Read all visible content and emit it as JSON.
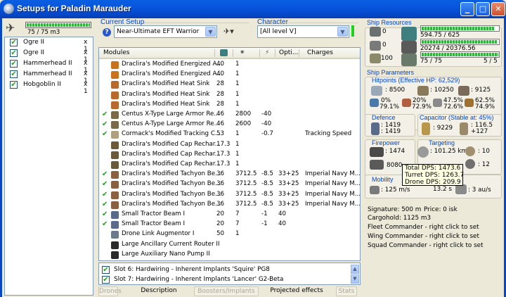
{
  "window": {
    "title": "Setups for Paladin Marauder",
    "minimize": "_",
    "maximize": "□",
    "close": "✕"
  },
  "cargo": {
    "text": "75 / 75 m3",
    "fill": 1.0
  },
  "drones": [
    {
      "name": "Ogre II",
      "qty": "x 1"
    },
    {
      "name": "Ogre II",
      "qty": "x 1"
    },
    {
      "name": "Hammerhead II",
      "qty": "x 1"
    },
    {
      "name": "Hammerhead II",
      "qty": "x 1"
    },
    {
      "name": "Hobgoblin II",
      "qty": "x 1"
    }
  ],
  "setup": {
    "label": "Current Setup",
    "value": "Near-Ultimate EFT Warrior"
  },
  "character": {
    "label": "Character",
    "value": "[All level V]"
  },
  "modules": {
    "headers": {
      "name": "Modules",
      "opti": "Opti...",
      "charges": "Charges"
    },
    "rows": [
      {
        "mark": "",
        "name": "Draclira's Modified Energized A...",
        "cpu": "40",
        "pg": "1",
        "range": "",
        "opti": "",
        "charges": "",
        "icon": "#c9741c"
      },
      {
        "mark": "",
        "name": "Draclira's Modified Energized A...",
        "cpu": "40",
        "pg": "1",
        "range": "",
        "opti": "",
        "charges": "",
        "icon": "#c9741c"
      },
      {
        "mark": "",
        "name": "Draclira's Modified Heat Sink",
        "cpu": "28",
        "pg": "1",
        "range": "",
        "opti": "",
        "charges": "",
        "icon": "#b86a2c"
      },
      {
        "mark": "",
        "name": "Draclira's Modified Heat Sink",
        "cpu": "28",
        "pg": "1",
        "range": "",
        "opti": "",
        "charges": "",
        "icon": "#b86a2c"
      },
      {
        "mark": "",
        "name": "Draclira's Modified Heat Sink",
        "cpu": "28",
        "pg": "1",
        "range": "",
        "opti": "",
        "charges": "",
        "icon": "#b86a2c"
      },
      {
        "mark": "✔",
        "name": "Centus X-Type Large Armor Re...",
        "cpu": "46",
        "pg": "2800",
        "range": "-40",
        "opti": "",
        "charges": "",
        "icon": "#7a6a4a"
      },
      {
        "mark": "✔",
        "name": "Centus A-Type Large Armor Re...",
        "cpu": "46",
        "pg": "2600",
        "range": "-40",
        "opti": "",
        "charges": "",
        "icon": "#7a6a4a"
      },
      {
        "mark": "✔",
        "name": "Cormack's Modified Tracking C...",
        "cpu": "53",
        "pg": "1",
        "range": "-0.7",
        "opti": "",
        "charges": "Tracking Speed",
        "icon": "#b0a080"
      },
      {
        "mark": "",
        "name": "Draclira's Modified Cap Rechar...",
        "cpu": "17.3",
        "pg": "1",
        "range": "",
        "opti": "",
        "charges": "",
        "icon": "#6a5a3a"
      },
      {
        "mark": "",
        "name": "Draclira's Modified Cap Rechar...",
        "cpu": "17.3",
        "pg": "1",
        "range": "",
        "opti": "",
        "charges": "",
        "icon": "#6a5a3a"
      },
      {
        "mark": "",
        "name": "Draclira's Modified Cap Rechar...",
        "cpu": "17.3",
        "pg": "1",
        "range": "",
        "opti": "",
        "charges": "",
        "icon": "#6a5a3a"
      },
      {
        "mark": "✔",
        "name": "Draclira's Modified Tachyon Be...",
        "cpu": "36",
        "pg": "3712.5",
        "range": "-8.5",
        "opti": "33+25",
        "charges": "Imperial Navy M...",
        "icon": "#8a6040"
      },
      {
        "mark": "✔",
        "name": "Draclira's Modified Tachyon Be...",
        "cpu": "36",
        "pg": "3712.5",
        "range": "-8.5",
        "opti": "33+25",
        "charges": "Imperial Navy M...",
        "icon": "#8a6040"
      },
      {
        "mark": "✔",
        "name": "Draclira's Modified Tachyon Be...",
        "cpu": "36",
        "pg": "3712.5",
        "range": "-8.5",
        "opti": "33+25",
        "charges": "Imperial Navy M...",
        "icon": "#8a6040"
      },
      {
        "mark": "✔",
        "name": "Draclira's Modified Tachyon Be...",
        "cpu": "36",
        "pg": "3712.5",
        "range": "-8.5",
        "opti": "33+25",
        "charges": "Imperial Navy M...",
        "icon": "#8a6040"
      },
      {
        "mark": "✔",
        "name": "Small Tractor Beam I",
        "cpu": "20",
        "pg": "7",
        "range": "-1",
        "opti": "40",
        "charges": "",
        "icon": "#5a6a8a"
      },
      {
        "mark": "✔",
        "name": "Small Tractor Beam I",
        "cpu": "20",
        "pg": "7",
        "range": "-1",
        "opti": "40",
        "charges": "",
        "icon": "#5a6a8a"
      },
      {
        "mark": "",
        "name": "Drone Link Augmentor I",
        "cpu": "50",
        "pg": "1",
        "range": "",
        "opti": "",
        "charges": "",
        "icon": "#6a7a8a"
      },
      {
        "mark": "",
        "name": "Large Ancillary Current Router II",
        "cpu": "",
        "pg": "",
        "range": "",
        "opti": "",
        "charges": "",
        "icon": "#2a2a2a"
      },
      {
        "mark": "",
        "name": "Large Auxiliary Nano Pump II",
        "cpu": "",
        "pg": "",
        "range": "",
        "opti": "",
        "charges": "",
        "icon": "#2a2a2a"
      }
    ]
  },
  "implants": [
    "Slot 6: Hardwiring - Inherent Implants 'Squire' PG8",
    "Slot 7: Hardwiring - Inherent Implants 'Lancer' G2-Beta"
  ],
  "tabs": {
    "drones": "Drones",
    "description": "Description",
    "boosters": "Boosters/Implants",
    "projected": "Projected effects",
    "stats": "Stats"
  },
  "resources": {
    "label": "Ship Resources",
    "hi": "0",
    "med": "0",
    "low": "100",
    "cpu": "594.75 / 625",
    "pg": "20274 / 20376.56",
    "drone": "75 / 75",
    "calib": "5 / 5",
    "cpu_fill": 0.95,
    "pg_fill": 0.995,
    "drone_fill": 1.0
  },
  "params": {
    "label": "Ship Parameters",
    "hitpoints": "Hitpoints (Effective HP: 62,529)",
    "shield": ": 8500",
    "armor": ": 10250",
    "hull": ": 9125",
    "res": [
      "0%",
      "79.1%",
      "20%",
      "72.9%",
      "47.5%",
      "72.6%",
      "62.5%",
      "74.9%"
    ],
    "defence_label": "Defence",
    "defence1": ": 1419",
    "defence2": ": 1419",
    "capacitor_label": "Capacitor (Stable at: 45%)",
    "cap": ": 9229",
    "cap_rate1": ": 116.5",
    "cap_rate2": "+127",
    "firepower_label": "Firepower",
    "fp1": ": 1474",
    "fp2": "8080",
    "targeting_label": "Targeting",
    "t_range": ": 101.25 km",
    "t_targets": ": 10",
    "t_res": ": 12",
    "mobility_label": "Mobility",
    "speed": ": 125 m/s",
    "align": "13.2 s",
    "warp": ": 3 au/s",
    "signature": "Signature: 500 m",
    "price": "Price: 0 isk",
    "cargohold": "Cargohold: 1125 m3",
    "fleet": "Fleet Commander - right click to set",
    "wing": "Wing Commander - right click to set",
    "squad": "Squad Commander - right click to set"
  },
  "tooltip": {
    "total": "Total DPS: 1473.6",
    "turret": "Turret DPS: 1263.7",
    "drone": "Drone DPS: 209.9"
  }
}
